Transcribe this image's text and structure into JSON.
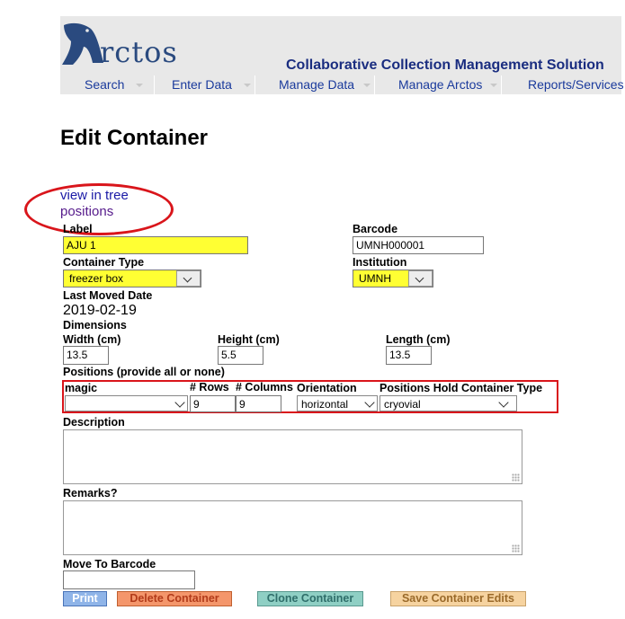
{
  "header": {
    "logo_text": "rctos",
    "tagline": "Collaborative Collection Management Solution",
    "nav": [
      "Search",
      "Enter Data",
      "Manage Data",
      "Manage Arctos",
      "Reports/Services"
    ]
  },
  "page": {
    "title": "Edit Container",
    "link_tree": "view in tree",
    "link_positions": "positions"
  },
  "form": {
    "label_label": "Label",
    "label_value": "AJU 1",
    "barcode_label": "Barcode",
    "barcode_value": "UMNH000001",
    "container_type_label": "Container Type",
    "container_type_value": "freezer box",
    "institution_label": "Institution",
    "institution_value": "UMNH",
    "last_moved_label": "Last Moved Date",
    "last_moved_value": "2019-02-19",
    "dimensions_label": "Dimensions",
    "width_label": "Width (cm)",
    "width_value": "13.5",
    "height_label": "Height (cm)",
    "height_value": "5.5",
    "length_label": "Length (cm)",
    "length_value": "13.5",
    "positions_label": "Positions (provide all or none)",
    "magic_label": "magic",
    "magic_value": "",
    "rows_label": "# Rows",
    "rows_value": "9",
    "columns_label": "# Columns",
    "columns_value": "9",
    "orientation_label": "Orientation",
    "orientation_value": "horizontal",
    "hold_type_label": "Positions Hold Container Type",
    "hold_type_value": "cryovial",
    "description_label": "Description",
    "remarks_label": "Remarks?",
    "move_to_label": "Move To Barcode",
    "move_to_value": ""
  },
  "buttons": {
    "print": "Print",
    "delete": "Delete Container",
    "clone": "Clone Container",
    "save": "Save Container Edits"
  },
  "colors": {
    "required_field": "#ffff33",
    "annotation_red": "#d9151b",
    "print_btn": "#8fb4e8",
    "delete_btn": "#f4966b",
    "clone_btn": "#8fcfc4",
    "save_btn": "#f6d3a0"
  }
}
